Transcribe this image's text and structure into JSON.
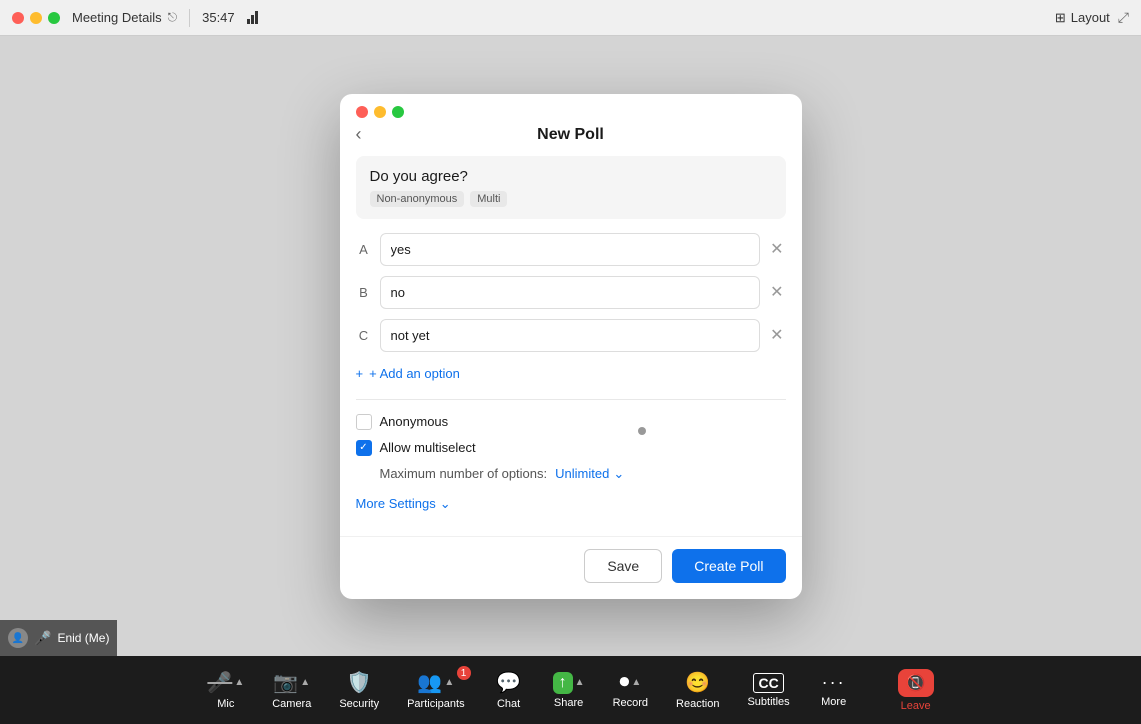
{
  "topbar": {
    "title": "Meeting Details",
    "timer": "35:47",
    "layout_label": "Layout"
  },
  "modal": {
    "title": "New Poll",
    "back_label": "‹",
    "question": {
      "text": "Do you agree?",
      "tags": [
        "Non-anonymous",
        "Multi"
      ]
    },
    "options": [
      {
        "letter": "A",
        "value": "yes"
      },
      {
        "letter": "B",
        "value": "no"
      },
      {
        "letter": "C",
        "value": "not yet"
      }
    ],
    "add_option_label": "+ Add an option",
    "anonymous_label": "Anonymous",
    "anonymous_checked": false,
    "multiselect_label": "Allow multiselect",
    "multiselect_checked": true,
    "max_options_label": "Maximum number of options:",
    "max_options_value": "Unlimited",
    "more_settings_label": "More Settings",
    "save_label": "Save",
    "create_label": "Create Poll"
  },
  "bottombar": {
    "items": [
      {
        "id": "mic",
        "label": "Mic",
        "icon": "🎤",
        "has_chevron": true,
        "muted": true
      },
      {
        "id": "camera",
        "label": "Camera",
        "icon": "📷",
        "has_chevron": true,
        "muted": true
      },
      {
        "id": "security",
        "label": "Security",
        "icon": "🛡️",
        "has_chevron": false
      },
      {
        "id": "participants",
        "label": "Participants",
        "icon": "👥",
        "has_chevron": true,
        "badge": "1"
      },
      {
        "id": "chat",
        "label": "Chat",
        "icon": "💬",
        "has_chevron": false
      },
      {
        "id": "share",
        "label": "Share",
        "icon": "↑",
        "has_chevron": true,
        "green": true
      },
      {
        "id": "record",
        "label": "Record",
        "icon": "⏺",
        "has_chevron": true
      },
      {
        "id": "reaction",
        "label": "Reaction",
        "icon": "😊",
        "has_chevron": false
      },
      {
        "id": "subtitles",
        "label": "Subtitles",
        "icon": "CC",
        "has_chevron": false
      },
      {
        "id": "more",
        "label": "More",
        "icon": "•••",
        "has_chevron": false
      },
      {
        "id": "leave",
        "label": "Leave",
        "icon": "📵",
        "has_chevron": false,
        "red": true
      }
    ]
  },
  "user": {
    "name": "Enid (Me)"
  }
}
